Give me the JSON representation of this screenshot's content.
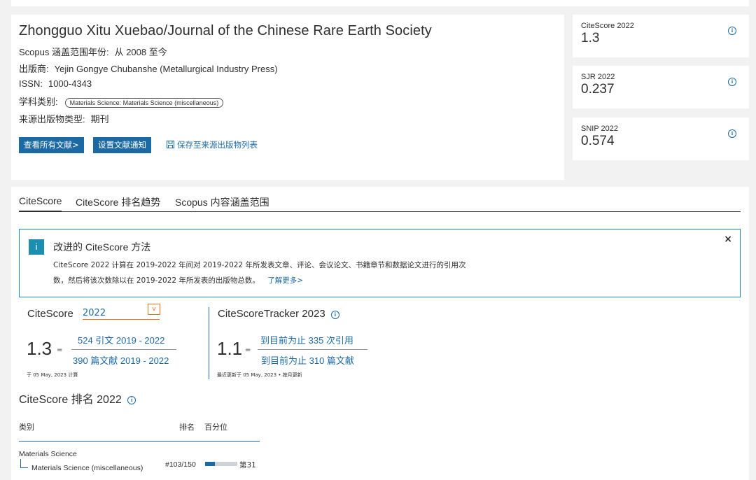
{
  "journal": {
    "title": "Zhongguo Xitu Xuebao/Journal of the Chinese Rare Earth Society",
    "coverage_label": "Scopus 涵盖范围年份:",
    "coverage_value": "从 2008 至今",
    "publisher_label": "出版商:",
    "publisher_value": "Yejin Gongye Chubanshe (Metallurgical Industry Press)",
    "issn_label": "ISSN:",
    "issn_value": "1000-4343",
    "subject_label": "学科类别:",
    "subject_value": "Materials Science: Materials Science (miscellaneous)",
    "source_type_label": "来源出版物类型:",
    "source_type_value": "期刊",
    "view_all_btn": "查看所有文献",
    "view_all_arrow": ">",
    "set_alert_btn": "设置文献通知",
    "save_link": "保存至来源出版物列表"
  },
  "metrics": [
    {
      "label": "CiteScore 2022",
      "value": "1.3"
    },
    {
      "label": "SJR 2022",
      "value": "0.237"
    },
    {
      "label": "SNIP 2022",
      "value": "0.574"
    }
  ],
  "tabs": [
    "CiteScore",
    "CiteScore 排名趋势",
    "Scopus 内容涵盖范围"
  ],
  "notice": {
    "icon_text": "i",
    "title": "改进的 CiteScore 方法",
    "body": "CiteScore 2022 计算在 2019-2022 年间对 2019-2022 年所发表文章、评论、会议论文、书籍章节和数据论文进行的引用次数，然后将该次数除以在 2019-2022 年所发表的出版物总数。",
    "learn_more": "了解更多",
    "learn_more_arrow": ">",
    "close": "×"
  },
  "citescore": {
    "title": "CiteScore",
    "year": "2022",
    "caret": "v",
    "value": "1.3",
    "eq": "=",
    "numerator": "524 引文 2019 - 2022",
    "denominator": "390 篇文献 2019 - 2022",
    "calc_date": "于 05 May, 2023 计算"
  },
  "tracker": {
    "title": "CiteScoreTracker 2023",
    "value": "1.1",
    "eq": "=",
    "numerator": "到目前为止 335 次引用",
    "denominator": "到目前为止 310 篇文献",
    "updated": "最近更新于 05 May, 2023 • 按月更新"
  },
  "ranking": {
    "title": "CiteScore 排名 2022",
    "col_category": "类别",
    "col_rank": "排名",
    "col_percentile": "百分位",
    "parent_category": "Materials Science",
    "child_category": "Materials Science (miscellaneous)",
    "rank": "#103/150",
    "percentile_label": "第31",
    "percentile_fraction": 0.31
  },
  "colors": {
    "accent": "#1c6aa4",
    "notice_border": "#1c8fb0",
    "select_accent": "#e8751a"
  },
  "icons": {
    "info": "info-icon",
    "save": "save-icon",
    "close": "close-icon"
  }
}
